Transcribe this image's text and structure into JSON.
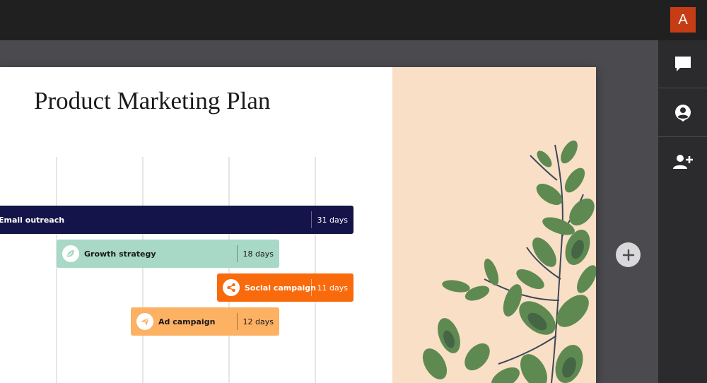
{
  "header": {
    "avatar_initial": "A"
  },
  "rail": {
    "items": [
      {
        "icon": "comment-icon"
      },
      {
        "icon": "account-circle-icon"
      },
      {
        "icon": "add-person-icon"
      }
    ]
  },
  "slide": {
    "title": "Product Marketing Plan",
    "tasks": [
      {
        "label": "Email outreach",
        "duration": "31 days",
        "color": "#14144a",
        "text_color": "#ffffff",
        "icon": "none"
      },
      {
        "label": "Growth strategy",
        "duration": "18 days",
        "color": "#a8d8c6",
        "text_color": "#1a1a1a",
        "icon": "leaf-icon"
      },
      {
        "label": "Social campaign",
        "duration": "11 days",
        "color": "#f96a0d",
        "text_color": "#ffffff",
        "icon": "share-icon"
      },
      {
        "label": "Ad campaign",
        "duration": "12 days",
        "color": "#fcb163",
        "text_color": "#1a1a1a",
        "icon": "paper-plane-icon"
      }
    ]
  },
  "colors": {
    "topbar": "#202020",
    "avatar": "#c63d15",
    "workspace": "#4b4b4f",
    "rail": "#2b2b2d",
    "slide_accent": "#f9dfc6"
  }
}
